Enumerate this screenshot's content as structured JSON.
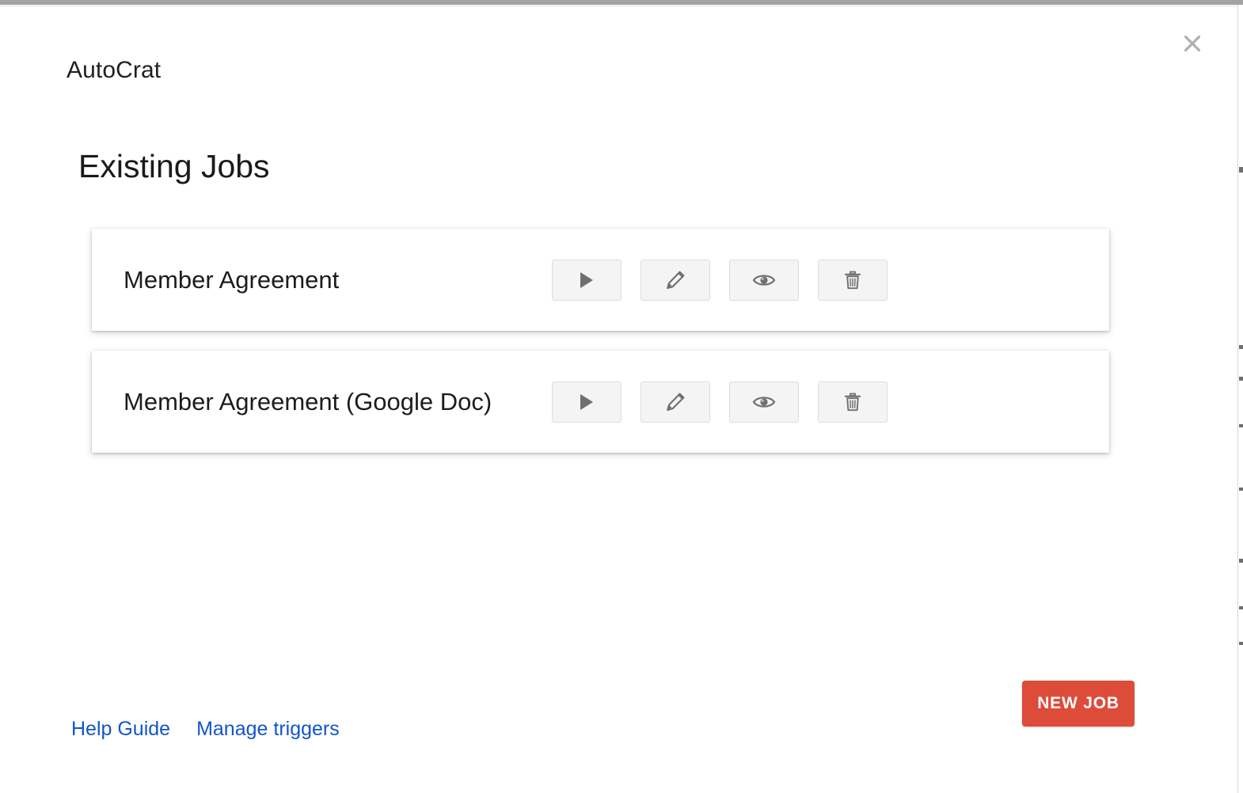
{
  "window": {
    "app_title": "AutoCrat",
    "close_label": "×"
  },
  "page": {
    "heading": "Existing Jobs"
  },
  "jobs": [
    {
      "name": "Member Agreement",
      "actions": [
        {
          "icon": "play-icon",
          "label": "Run"
        },
        {
          "icon": "pencil-icon",
          "label": "Edit"
        },
        {
          "icon": "eye-icon",
          "label": "Preview"
        },
        {
          "icon": "trash-icon",
          "label": "Delete"
        }
      ]
    },
    {
      "name": "Member Agreement (Google Doc)",
      "actions": [
        {
          "icon": "play-icon",
          "label": "Run"
        },
        {
          "icon": "pencil-icon",
          "label": "Edit"
        },
        {
          "icon": "eye-icon",
          "label": "Preview"
        },
        {
          "icon": "trash-icon",
          "label": "Delete"
        }
      ]
    }
  ],
  "footer": {
    "help_guide_label": "Help Guide",
    "manage_triggers_label": "Manage triggers",
    "new_job_label": "NEW JOB"
  },
  "colors": {
    "accent_red": "#dd4b39",
    "link_blue": "#1155cc",
    "button_face": "#f4f4f4",
    "icon_gray": "#757575"
  }
}
